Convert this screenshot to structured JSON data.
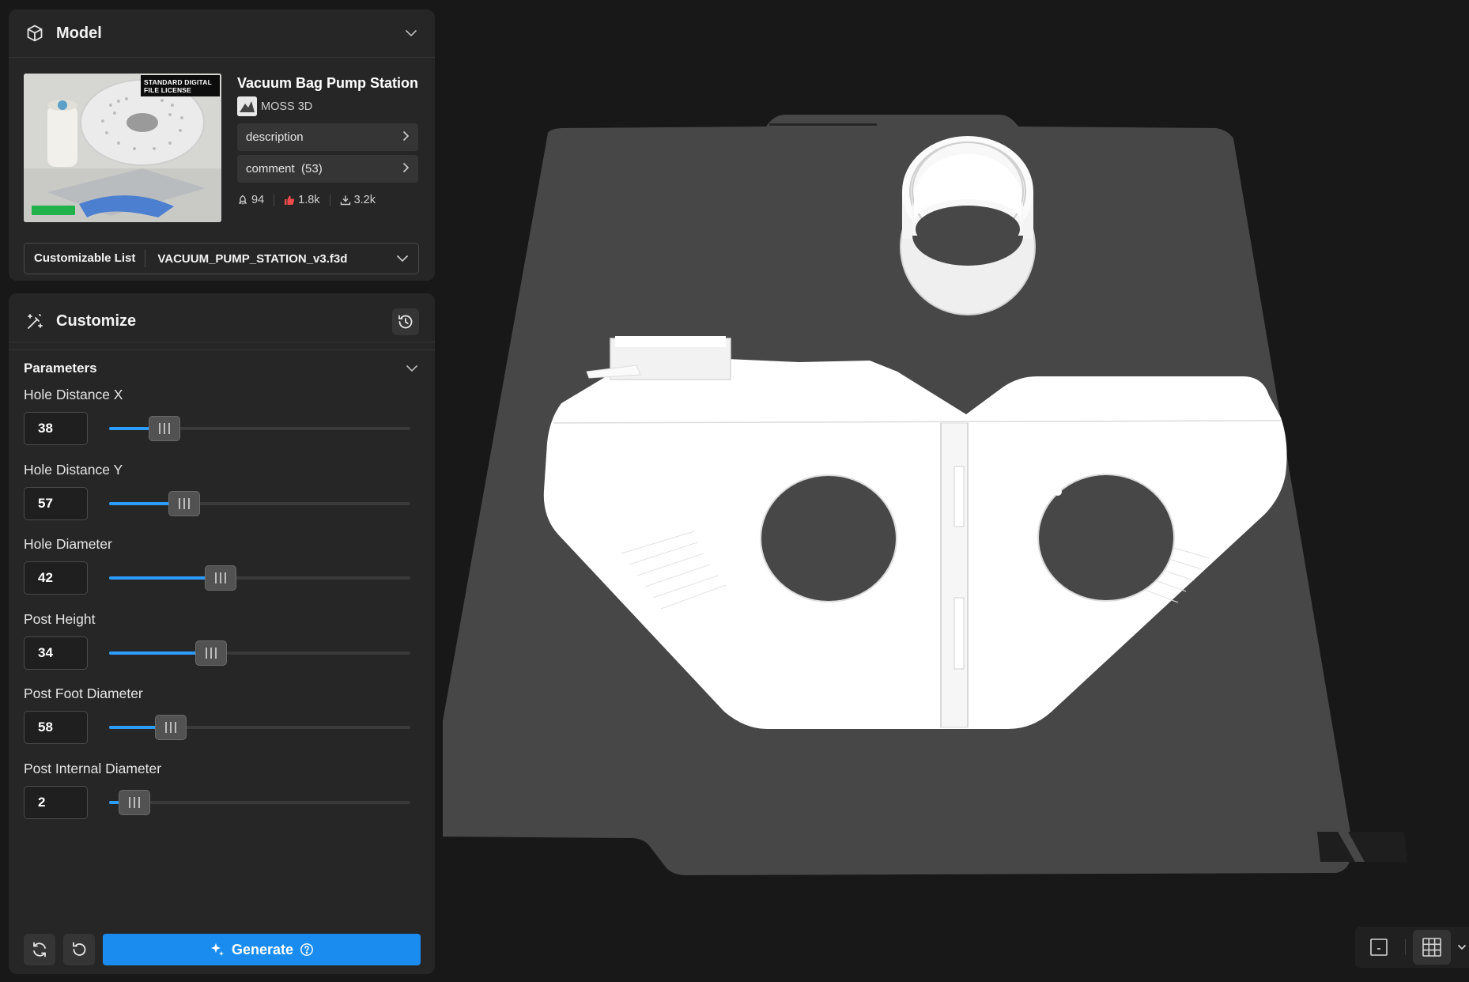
{
  "model_panel": {
    "title": "Model",
    "thumbnail_badge": "STANDARD DIGITAL FILE LICENSE",
    "model_title": "Vacuum Bag Pump Station",
    "author": "MOSS 3D",
    "links": [
      {
        "label": "description"
      },
      {
        "label": "comment  (53)"
      }
    ],
    "stats": {
      "boosts": "94",
      "likes": "1.8k",
      "downloads": "3.2k"
    },
    "customizable_list": {
      "label": "Customizable List",
      "value": "VACUUM_PUMP_STATION_v3.f3d"
    }
  },
  "customize_panel": {
    "title": "Customize",
    "section_title": "Parameters",
    "params": [
      {
        "label": "Hole Distance X",
        "value": "38",
        "fraction": 0.1
      },
      {
        "label": "Hole Distance Y",
        "value": "57",
        "fraction": 0.165
      },
      {
        "label": "Hole Diameter",
        "value": "42",
        "fraction": 0.285
      },
      {
        "label": "Post Height",
        "value": "34",
        "fraction": 0.255
      },
      {
        "label": "Post Foot Diameter",
        "value": "58",
        "fraction": 0.12
      },
      {
        "label": "Post Internal Diameter",
        "value": "2",
        "fraction": 0.0
      }
    ],
    "generate_label": "Generate"
  },
  "colors": {
    "accent": "#1a8cf0",
    "slider_fill": "#2d9cff",
    "panel_bg": "#262626",
    "app_bg": "#181818"
  },
  "icons": {
    "model": "cube-icon",
    "customize": "magic-wand-icon",
    "history": "history-icon",
    "sync": "refresh-icon",
    "reset": "undo-icon",
    "generate": "sparkle-icon",
    "help": "help-circle-icon",
    "plate_view": "plate-icon",
    "grid_view": "grid-icon"
  }
}
